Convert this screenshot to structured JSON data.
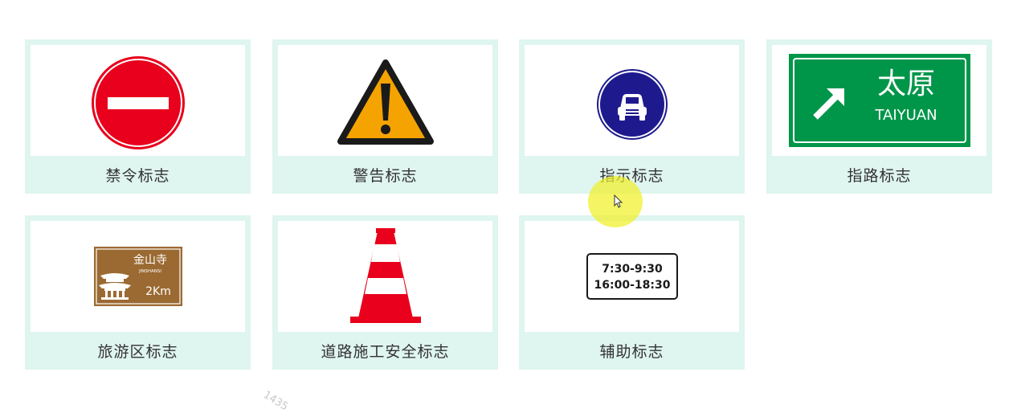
{
  "cards": [
    {
      "label": "禁令标志",
      "icon": "no-entry-sign"
    },
    {
      "label": "警告标志",
      "icon": "warning-sign"
    },
    {
      "label": "指示标志",
      "icon": "motor-vehicle-lane-sign"
    },
    {
      "label": "指路标志",
      "icon": "direction-sign",
      "sign_text": {
        "cn": "太原",
        "en": "TAIYUAN"
      }
    },
    {
      "label": "旅游区标志",
      "icon": "tourist-sign",
      "sign_text": {
        "cn": "金山寺",
        "en": "JINSHANSI",
        "distance": "2Km"
      }
    },
    {
      "label": "道路施工安全标志",
      "icon": "traffic-cone"
    },
    {
      "label": "辅助标志",
      "icon": "time-plate-sign",
      "sign_text": {
        "line1": "7:30-9:30",
        "line2": "16:00-18:30"
      }
    }
  ],
  "watermark": "1435",
  "colors": {
    "card_bg": "#dff5ef",
    "prohibition_red": "#e8001c",
    "warning_orange": "#f4a300",
    "mandatory_blue": "#1e1a8e",
    "guide_green": "#00964a",
    "tourist_brown": "#9b6a32"
  }
}
